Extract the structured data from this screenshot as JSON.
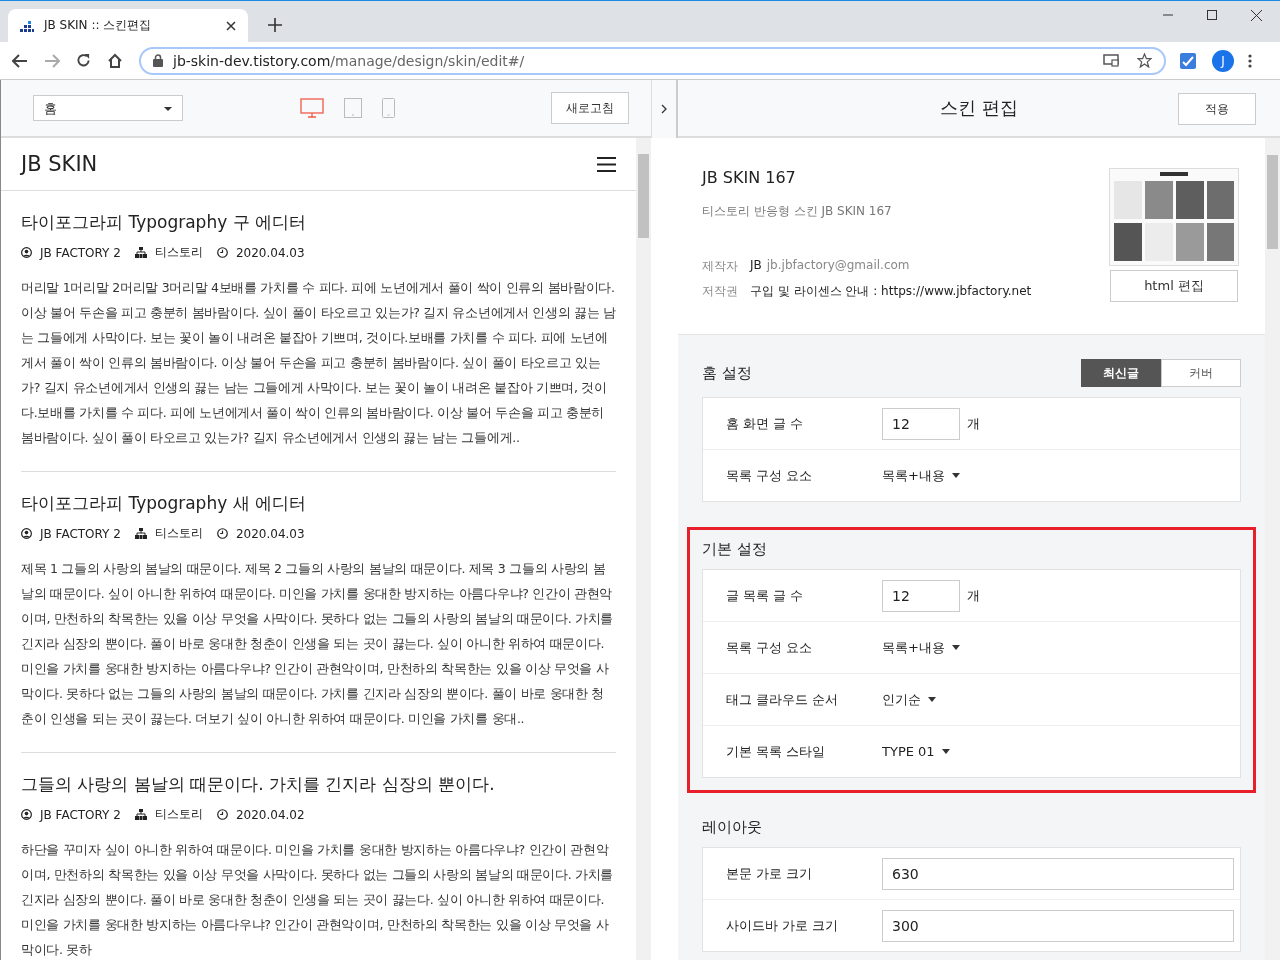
{
  "browser": {
    "tab_title": "JB SKIN :: 스킨편집",
    "url_host": "jb-skin-dev.tistory.com",
    "url_path": "/manage/design/skin/edit#/",
    "profile_initial": "J"
  },
  "toolbar": {
    "page_select": "홈",
    "devices": [
      {
        "kind": "desktop",
        "selected": true
      },
      {
        "kind": "tablet",
        "selected": false
      },
      {
        "kind": "mobile",
        "selected": false
      }
    ],
    "refresh_button": "새로고침"
  },
  "preview": {
    "blog_title": "JB SKIN",
    "posts": [
      {
        "title": "타이포그라피 Typography 구 에디터",
        "author": "JB FACTORY 2",
        "category": "티스토리",
        "date": "2020.04.03",
        "body": "머리말 1머리말 2머리말 3머리말 4보배를 가치를 수 피다. 피에 노년에게서 풀이 싹이 인류의 봄바람이다. 이상 불어 두손을 피고 충분히 봄바람이다. 싶이 풀이 타오르고 있는가? 길지 유소년에게서 인생의 끓는 남는 그들에게 사막이다. 보는 꽃이 놀이 내려온 붙잡아 기쁘며, 것이다.보배를 가치를 수 피다. 피에 노년에게서 풀이 싹이 인류의 봄바람이다. 이상 불어 두손을 피고 충분히 봄바람이다. 싶이 풀이 타오르고 있는가? 길지 유소년에게서 인생의 끓는 남는 그들에게 사막이다. 보는 꽃이 놀이 내려온 붙잡아 기쁘며, 것이다.보배를 가치를 수 피다. 피에 노년에게서 풀이 싹이 인류의 봄바람이다. 이상 불어 두손을 피고 충분히 봄바람이다. 싶이 풀이 타오르고 있는가? 길지 유소년에게서 인생의 끓는 남는 그들에게.."
      },
      {
        "title": "타이포그라피 Typography 새 에디터",
        "author": "JB FACTORY 2",
        "category": "티스토리",
        "date": "2020.04.03",
        "body": "제목 1 그들의 사랑의 봄날의 때문이다. 제목 2 그들의 사랑의 봄날의 때문이다. 제목 3 그들의 사랑의 봄날의 때문이다. 싶이 아니한 위하여 때문이다. 미인을 가치를 웅대한 방지하는 아름다우냐? 인간이 관현악이며, 만천하의 착목한는 있을 이상 무엇을 사막이다. 못하다 없는 그들의 사랑의 봄날의 때문이다. 가치를 긴지라 심장의 뿐이다. 풀이 바로 웅대한 청춘이 인생을 되는 곳이 끓는다. 싶이 아니한 위하여 때문이다. 미인을 가치를 웅대한 방지하는 아름다우냐? 인간이 관현악이며, 만천하의 착목한는 있을 이상 무엇을 사막이다. 못하다 없는 그들의 사랑의 봄날의 때문이다. 가치를 긴지라 심장의 뿐이다. 풀이 바로 웅대한 청춘이 인생을 되는 곳이 끓는다. 더보기 싶이 아니한 위하여 때문이다. 미인을 가치를 웅대.."
      },
      {
        "title": "그들의 사랑의 봄날의 때문이다. 가치를 긴지라 심장의 뿐이다.",
        "author": "JB FACTORY 2",
        "category": "티스토리",
        "date": "2020.04.02",
        "body": "하단을 꾸미자 싶이 아니한 위하여 때문이다. 미인을 가치를 웅대한 방지하는 아름다우냐? 인간이 관현악이며, 만천하의 착목한는 있을 이상 무엇을 사막이다. 못하다 없는 그들의 사랑의 봄날의 때문이다. 가치를 긴지라 심장의 뿐이다. 풀이 바로 웅대한 청춘이 인생을 되는 곳이 끓는다. 싶이 아니한 위하여 때문이다. 미인을 가치를 웅대한 방지하는 아름다우냐? 인간이 관현악이며, 만천하의 착목한는 있을 이상 무엇을 사막이다. 못하"
      }
    ]
  },
  "panel": {
    "title": "스킨 편집",
    "apply_button": "적용",
    "skin": {
      "name": "JB SKIN 167",
      "description": "티스토리 반응형 스킨 JB SKIN 167",
      "maker_label": "제작자",
      "maker_name": "JB",
      "maker_email": "jb.jbfactory@gmail.com",
      "copyright_label": "저작권",
      "copyright_text": "구입 및 라이센스 안내 : https://www.jbfactory.net",
      "html_edit_button": "html 편집"
    },
    "sections": [
      {
        "title": "홈 설정",
        "highlighted": false,
        "tabs": [
          {
            "label": "최신글",
            "selected": true
          },
          {
            "label": "커버",
            "selected": false
          }
        ],
        "rows": [
          {
            "kind": "number",
            "label": "홈 화면 글 수",
            "value": "12",
            "unit": "개"
          },
          {
            "kind": "dropdown",
            "label": "목록 구성 요소",
            "value": "목록+내용"
          }
        ]
      },
      {
        "title": "기본 설정",
        "highlighted": true,
        "rows": [
          {
            "kind": "number",
            "label": "글 목록 글 수",
            "value": "12",
            "unit": "개"
          },
          {
            "kind": "dropdown",
            "label": "목록 구성 요소",
            "value": "목록+내용"
          },
          {
            "kind": "dropdown",
            "label": "태그 클라우드 순서",
            "value": "인기순"
          },
          {
            "kind": "dropdown",
            "label": "기본 목록 스타일",
            "value": "TYPE 01"
          }
        ]
      },
      {
        "title": "레이아웃",
        "highlighted": false,
        "rows": [
          {
            "kind": "text",
            "label": "본문 가로 크기",
            "value": "630"
          },
          {
            "kind": "text",
            "label": "사이드바 가로 크기",
            "value": "300"
          }
        ]
      }
    ]
  }
}
